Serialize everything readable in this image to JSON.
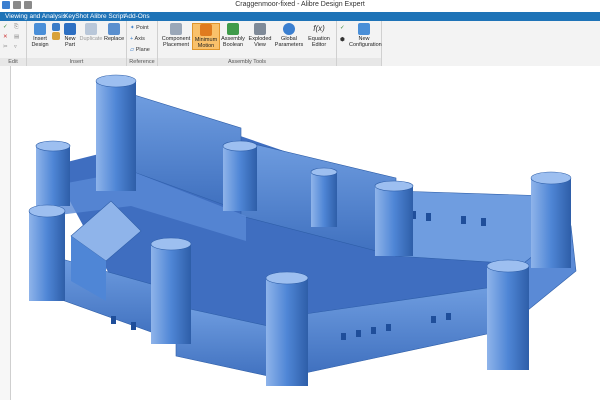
{
  "window": {
    "title": "Craggenmoor-fixed - Alibre Design Expert"
  },
  "menu": {
    "items": [
      "Viewing and Analysis",
      "KeyShot",
      "Alibre Script",
      "Add-Ons"
    ]
  },
  "ribbon": {
    "groups": {
      "edit": "Edit",
      "insert": "Insert",
      "reference": "Reference",
      "assembly_tools": "Assembly Tools"
    },
    "insert_design": "Insert\nDesign",
    "new_part": "New\nPart",
    "duplicate": "Duplicate",
    "replace": "Replace",
    "point": "Point",
    "axis": "Axis",
    "plane": "Plane",
    "component_placement": "Component\nPlacement",
    "minimum_motion": "Minimum\nMotion",
    "assembly_boolean": "Assembly\nBoolean",
    "exploded_view": "Exploded\nView",
    "global_parameters": "Global\nParameters",
    "equation_editor": "Equation\nEditor",
    "new_configuration": "New\nConfiguration",
    "equation_glyph": "f(x)"
  },
  "viewport": {
    "model": "castle-assembly",
    "model_color": "#4f86d6",
    "dark_color": "#2e5ea8",
    "light_color": "#8fb4ea"
  },
  "colors": {
    "menubar": "#1e73b7",
    "highlight": "#f9c16b"
  }
}
